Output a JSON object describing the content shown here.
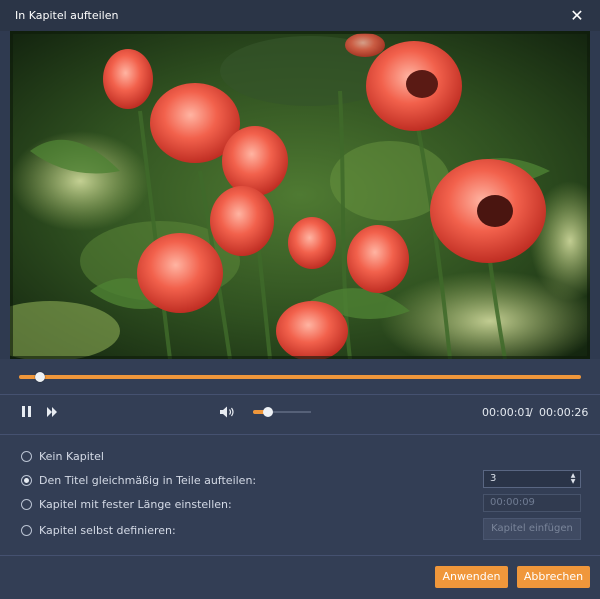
{
  "dialog": {
    "title": "In Kapitel aufteilen",
    "close_icon": "close-icon"
  },
  "player": {
    "progress": 0.038,
    "volume": 0.2,
    "current_time": "00:00:01",
    "separator": "/",
    "total_time": "00:00:26",
    "icons": [
      "pause-icon",
      "fast-forward-icon",
      "volume-icon"
    ]
  },
  "options": {
    "none": "Kein Kapitel",
    "even": "Den Titel gleichmäßig in Teile aufteilen:",
    "fixed": "Kapitel mit fester Länge einstellen:",
    "custom": "Kapitel selbst definieren:",
    "selected": "even"
  },
  "inputs": {
    "parts_value": "3",
    "length_placeholder": "00:00:09",
    "insert_chapter_label": "Kapitel einfügen"
  },
  "footer": {
    "apply_label": "Anwenden",
    "cancel_label": "Abbrechen"
  },
  "colors": {
    "accent": "#f0973b",
    "background": "#333e55",
    "titlebar": "#2b3547"
  }
}
